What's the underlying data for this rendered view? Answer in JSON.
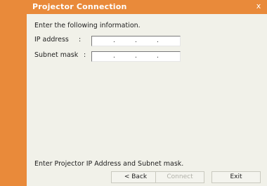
{
  "window": {
    "title": "Projector Connection",
    "close_glyph": "x"
  },
  "form": {
    "instruction": "Enter the following information.",
    "colon": ":",
    "ip_address": {
      "label": "IP address",
      "value": "",
      "dot": "."
    },
    "subnet_mask": {
      "label": "Subnet mask",
      "value": "",
      "dot": "."
    }
  },
  "status": {
    "text": "Enter Projector IP Address and Subnet mask."
  },
  "buttons": {
    "back": "< Back",
    "connect": "Connect",
    "exit": "Exit"
  },
  "colors": {
    "accent": "#e98a3a",
    "panel": "#f1f1e9"
  },
  "icons": {
    "close": "close-icon"
  }
}
